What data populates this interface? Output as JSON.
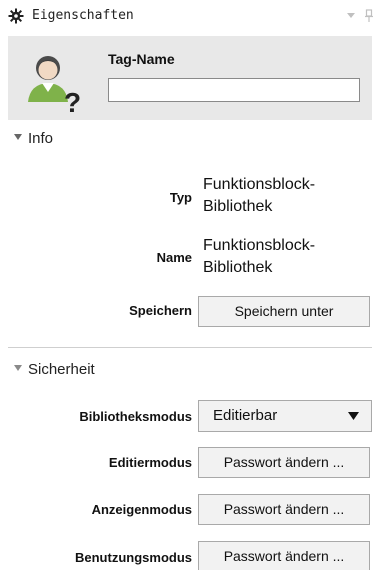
{
  "window": {
    "title": "Eigenschaften",
    "icons": [
      "gear-icon",
      "dropdown-icon",
      "pin-icon"
    ]
  },
  "tag": {
    "label": "Tag-Name",
    "value": "",
    "icon": "unknown-user-icon"
  },
  "info": {
    "header": "Info",
    "type_label": "Typ",
    "type_value_line1": "Funktionsblock-",
    "type_value_line2": "Bibliothek",
    "name_label": "Name",
    "name_value_line1": "Funktionsblock-",
    "name_value_line2": "Bibliothek",
    "save_label": "Speichern",
    "save_button": "Speichern unter"
  },
  "security": {
    "header": "Sicherheit",
    "library_mode_label": "Bibliotheksmodus",
    "library_mode_value": "Editierbar",
    "edit_mode_label": "Editiermodus",
    "edit_mode_button": "Passwort ändern ...",
    "view_mode_label": "Anzeigenmodus",
    "view_mode_button": "Passwort ändern ...",
    "usage_mode_label": "Benutzungsmodus",
    "usage_mode_button": "Passwort ändern ..."
  },
  "colors": {
    "header_bg": "#e8e8e8",
    "button_bg": "#f2f2f2",
    "button_border": "#a9a9a9",
    "avatar_green": "#7fb24a"
  }
}
